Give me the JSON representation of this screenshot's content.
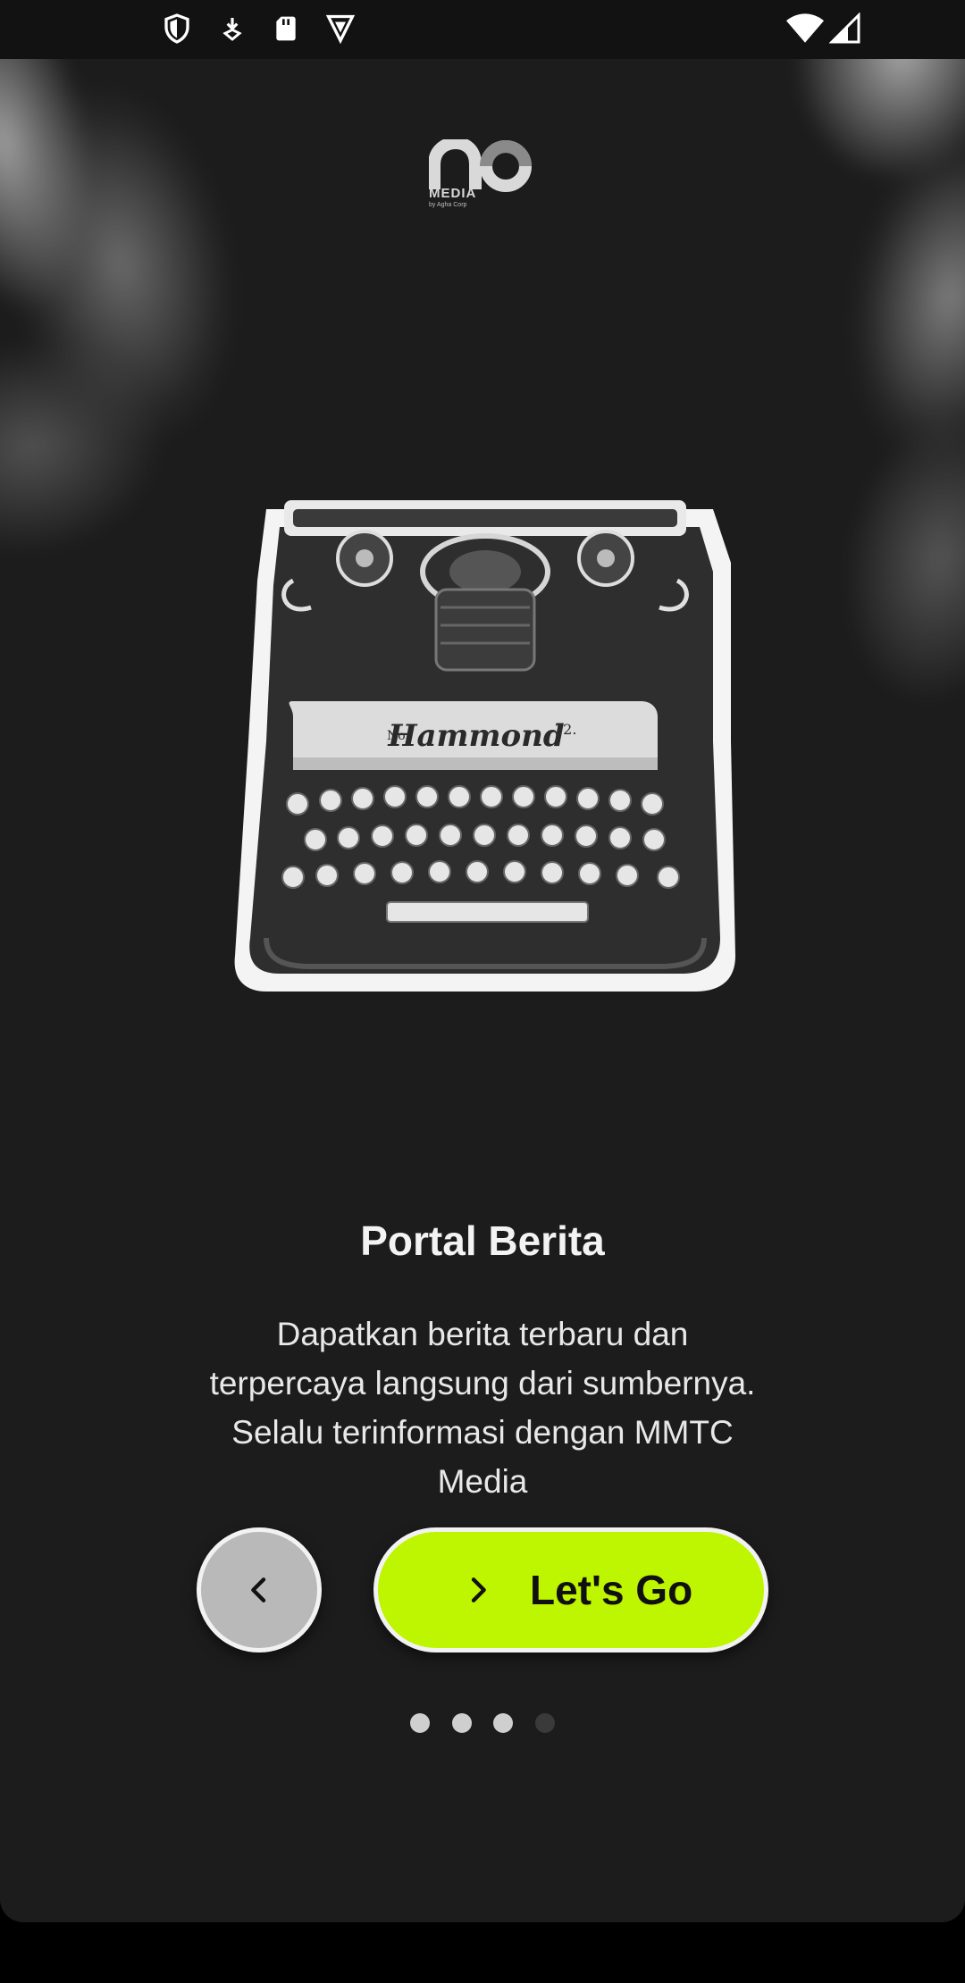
{
  "status_bar": {
    "left_icons": [
      "shield-icon",
      "download-icon",
      "sd-card-icon",
      "vpn-icon"
    ],
    "right_icons": [
      "wifi-icon",
      "signal-icon"
    ]
  },
  "logo": {
    "mark_text": "MEDIA",
    "sub_text": "by Agha Corp"
  },
  "onboarding": {
    "title": "Portal Berita",
    "description_lines": [
      "Dapatkan berita terbaru dan",
      "terpercaya langsung dari sumbernya.",
      "Selalu terinformasi dengan MMTC",
      "Media"
    ]
  },
  "actions": {
    "back_icon": "chevron-left-icon",
    "next_icon": "chevron-right-icon",
    "go_label": "Let's Go"
  },
  "pager": {
    "total": 4,
    "active_pages": [
      1,
      2,
      3
    ],
    "current": 3
  },
  "colors": {
    "accent": "#bef500",
    "background": "#1c1c1d",
    "back_button": "#b9b9ba"
  }
}
